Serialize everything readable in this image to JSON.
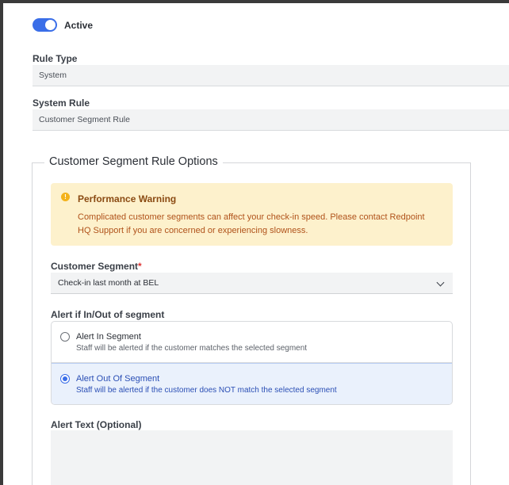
{
  "active": {
    "label": "Active",
    "enabled": true
  },
  "rule_type": {
    "label": "Rule Type",
    "value": "System"
  },
  "system_rule": {
    "label": "System Rule",
    "value": "Customer Segment Rule"
  },
  "options": {
    "legend": "Customer Segment Rule Options",
    "warning": {
      "title": "Performance Warning",
      "body": "Complicated customer segments can affect your check-in speed. Please contact Redpoint HQ Support if you are concerned or experiencing slowness.",
      "icon": "exclamation-circle-icon"
    },
    "segment": {
      "label": "Customer Segment",
      "required_mark": "*",
      "value": "Check-in last month at BEL"
    },
    "alert_mode": {
      "label": "Alert if In/Out of segment",
      "options": [
        {
          "title": "Alert In Segment",
          "desc": "Staff will be alerted if the customer matches the selected segment",
          "selected": false
        },
        {
          "title": "Alert Out Of Segment",
          "desc": "Staff will be alerted if the customer does NOT match the selected segment",
          "selected": true
        }
      ]
    },
    "alert_text": {
      "label": "Alert Text (Optional)",
      "value": ""
    }
  },
  "colors": {
    "accent": "#3a6ee8",
    "warning_bg": "#fdf1cc",
    "warning_text": "#b0521a"
  }
}
